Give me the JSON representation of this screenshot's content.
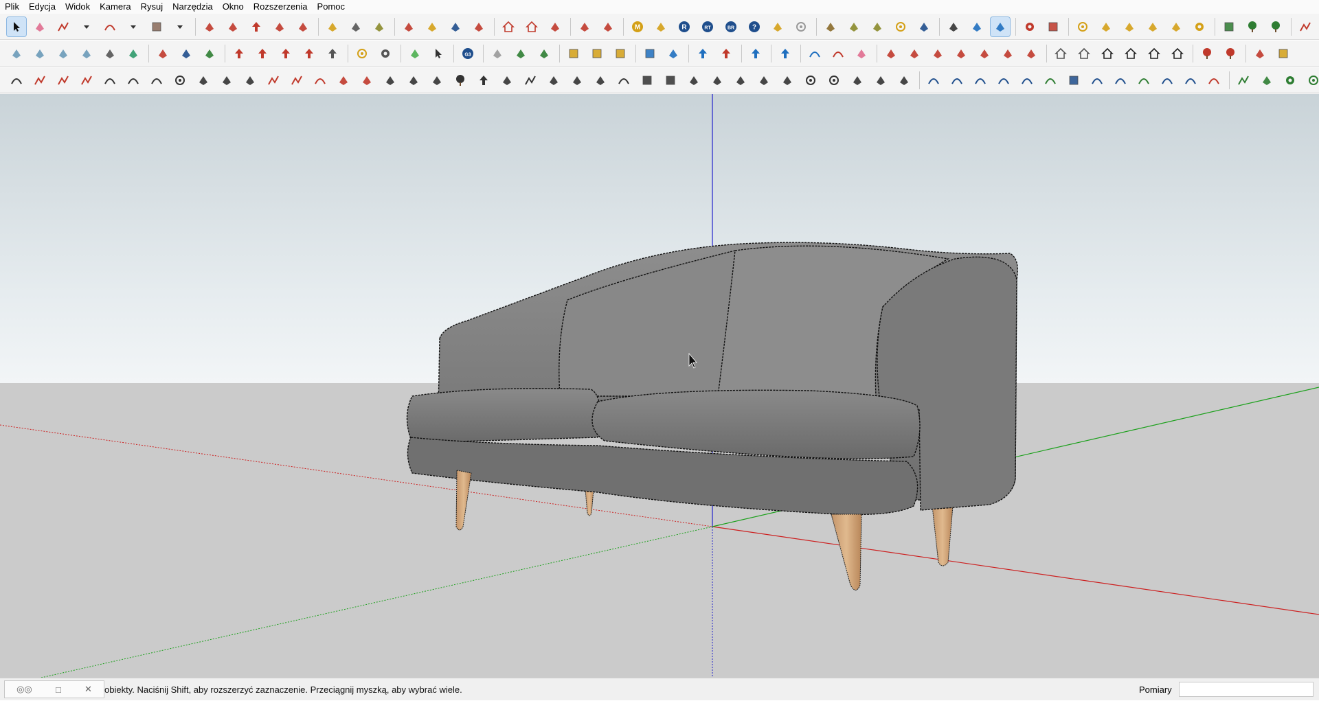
{
  "menu": [
    "Plik",
    "Edycja",
    "Widok",
    "Kamera",
    "Rysuj",
    "Narzędzia",
    "Okno",
    "Rozszerzenia",
    "Pomoc"
  ],
  "toolbar1": [
    {
      "name": "select-icon",
      "color": "#111111",
      "active": true
    },
    {
      "name": "eraser-icon",
      "color": "#e06d8f"
    },
    {
      "name": "pencil-line-icon",
      "color": "#c0392b"
    },
    {
      "name": "dropdown-arrow-icon",
      "color": "#333333"
    },
    {
      "name": "arc-icon",
      "color": "#c0392b"
    },
    {
      "name": "dropdown-arrow-icon",
      "color": "#333333"
    },
    {
      "name": "rectangle-icon",
      "color": "#8a6a5a"
    },
    {
      "name": "dropdown-arrow-icon",
      "color": "#333333"
    },
    {
      "name": "sep"
    },
    {
      "name": "push-pull-icon",
      "color": "#c0392b"
    },
    {
      "name": "follow-me-icon",
      "color": "#c0392b"
    },
    {
      "name": "move-icon",
      "color": "#c0392b"
    },
    {
      "name": "rotate-icon",
      "color": "#c0392b"
    },
    {
      "name": "scale-icon",
      "color": "#c0392b"
    },
    {
      "name": "sep"
    },
    {
      "name": "tape-measure-icon",
      "color": "#d4a017"
    },
    {
      "name": "text-icon",
      "color": "#555555"
    },
    {
      "name": "paint-bucket-icon",
      "color": "#8a8a2a"
    },
    {
      "name": "sep"
    },
    {
      "name": "orbit-icon",
      "color": "#c0392b"
    },
    {
      "name": "pan-icon",
      "color": "#d4a017"
    },
    {
      "name": "zoom-icon",
      "color": "#1f4e8c"
    },
    {
      "name": "zoom-extents-icon",
      "color": "#c0392b"
    },
    {
      "name": "sep"
    },
    {
      "name": "warehouse-icon",
      "color": "#c0392b"
    },
    {
      "name": "extension-warehouse-icon",
      "color": "#c0392b"
    },
    {
      "name": "layout-icon",
      "color": "#c0392b"
    },
    {
      "name": "sep"
    },
    {
      "name": "record-icon",
      "color": "#c0392b"
    },
    {
      "name": "vray-icon",
      "color": "#c0392b"
    },
    {
      "name": "sep"
    },
    {
      "name": "m-icon",
      "color": "#d4a017",
      "label": "M"
    },
    {
      "name": "tag-icon",
      "color": "#d4a017"
    },
    {
      "name": "r-icon",
      "color": "#1f4e8c",
      "label": "R"
    },
    {
      "name": "rt-icon",
      "color": "#1f4e8c",
      "label": "RT"
    },
    {
      "name": "br-icon",
      "color": "#1f4e8c",
      "label": "BR"
    },
    {
      "name": "help-icon",
      "color": "#1f4e8c",
      "label": "?"
    },
    {
      "name": "tag2-icon",
      "color": "#d4a017"
    },
    {
      "name": "sphere-icon",
      "color": "#999999"
    },
    {
      "name": "sep"
    },
    {
      "name": "cross-icon",
      "color": "#8a6a2a"
    },
    {
      "name": "terrain-icon",
      "color": "#8a8a2a"
    },
    {
      "name": "terrain2-icon",
      "color": "#8a8a2a"
    },
    {
      "name": "target-icon",
      "color": "#d4a017"
    },
    {
      "name": "pause-icon",
      "color": "#1f4e8c"
    },
    {
      "name": "sep"
    },
    {
      "name": "section-icon",
      "color": "#333333"
    },
    {
      "name": "camera-icon",
      "color": "#1f6fbf"
    },
    {
      "name": "render-icon",
      "color": "#1f6fbf",
      "active": true
    },
    {
      "name": "sep"
    },
    {
      "name": "gear-icon",
      "color": "#c0392b"
    },
    {
      "name": "grid-icon",
      "color": "#c0392b"
    },
    {
      "name": "sep"
    },
    {
      "name": "dot-icon",
      "color": "#d4a017"
    },
    {
      "name": "hat-icon",
      "color": "#d4a017"
    },
    {
      "name": "flag-icon",
      "color": "#d4a017"
    },
    {
      "name": "dome-icon",
      "color": "#d4a017"
    },
    {
      "name": "dome2-icon",
      "color": "#d4a017"
    },
    {
      "name": "key-icon",
      "color": "#d4a017"
    },
    {
      "name": "sep"
    },
    {
      "name": "window-icon",
      "color": "#2e7d32"
    },
    {
      "name": "tree-icon",
      "color": "#2e7d32"
    },
    {
      "name": "tree2-icon",
      "color": "#2e7d32"
    },
    {
      "name": "sep"
    },
    {
      "name": "pen-icon",
      "color": "#c0392b"
    }
  ],
  "toolbar2": [
    {
      "name": "iso-view-icon",
      "color": "#6a9ab8"
    },
    {
      "name": "top-view-icon",
      "color": "#6a9ab8"
    },
    {
      "name": "front-view-icon",
      "color": "#6a9ab8"
    },
    {
      "name": "right-view-icon",
      "color": "#6a9ab8"
    },
    {
      "name": "back-view-icon",
      "color": "#555555"
    },
    {
      "name": "left-view-icon",
      "color": "#2e9a6a"
    },
    {
      "name": "sep"
    },
    {
      "name": "solid-tool-icon",
      "color": "#c0392b"
    },
    {
      "name": "solid-tool2-icon",
      "color": "#1f4e8c"
    },
    {
      "name": "solid-tool3-icon",
      "color": "#2e7d32"
    },
    {
      "name": "sep"
    },
    {
      "name": "arrow-tool-icon",
      "color": "#c0392b"
    },
    {
      "name": "arrow-tool2-icon",
      "color": "#c0392b"
    },
    {
      "name": "arrow-tool3-icon",
      "color": "#c0392b"
    },
    {
      "name": "arrow-tool4-icon",
      "color": "#c0392b"
    },
    {
      "name": "arrow-tool5-icon",
      "color": "#555555"
    },
    {
      "name": "sep"
    },
    {
      "name": "compass-icon",
      "color": "#d4a017"
    },
    {
      "name": "tools-icon",
      "color": "#555555"
    },
    {
      "name": "sep"
    },
    {
      "name": "palette-icon",
      "color": "#4caf50"
    },
    {
      "name": "cursor-icon",
      "color": "#333333"
    },
    {
      "name": "sep"
    },
    {
      "name": "g3-icon",
      "color": "#1f4e8c",
      "label": "G3"
    },
    {
      "name": "sep"
    },
    {
      "name": "shell-icon",
      "color": "#999999"
    },
    {
      "name": "nodes-icon",
      "color": "#2e7d32"
    },
    {
      "name": "mesh-icon",
      "color": "#2e7d32"
    },
    {
      "name": "sep"
    },
    {
      "name": "box-icon",
      "color": "#d4a017"
    },
    {
      "name": "box2-icon",
      "color": "#d4a017"
    },
    {
      "name": "box3-icon",
      "color": "#d4a017"
    },
    {
      "name": "sep"
    },
    {
      "name": "cube-icon",
      "color": "#1f6fbf"
    },
    {
      "name": "bar-icon",
      "color": "#1f6fbf"
    },
    {
      "name": "sep"
    },
    {
      "name": "arrows-up-icon",
      "color": "#1f6fbf"
    },
    {
      "name": "arrows-up2-icon",
      "color": "#c0392b"
    },
    {
      "name": "sep"
    },
    {
      "name": "diag-arrow-icon",
      "color": "#1f6fbf"
    },
    {
      "name": "sep"
    },
    {
      "name": "flip-icon",
      "color": "#1f6fbf"
    },
    {
      "name": "sep"
    },
    {
      "name": "undo-curve-icon",
      "color": "#1f6fbf"
    },
    {
      "name": "redo-curve-icon",
      "color": "#c0392b"
    },
    {
      "name": "hand-icon",
      "color": "#e06d8f"
    },
    {
      "name": "sep"
    },
    {
      "name": "stair-icon",
      "color": "#c0392b"
    },
    {
      "name": "stair2-icon",
      "color": "#c0392b"
    },
    {
      "name": "ar-icon",
      "color": "#c0392b"
    },
    {
      "name": "av-icon",
      "color": "#c0392b"
    },
    {
      "name": "an-icon",
      "color": "#c0392b"
    },
    {
      "name": "ax-icon",
      "color": "#c0392b"
    },
    {
      "name": "af-icon",
      "color": "#c0392b"
    },
    {
      "name": "sep"
    },
    {
      "name": "house-icon",
      "color": "#555555"
    },
    {
      "name": "door-icon",
      "color": "#555555"
    },
    {
      "name": "home-icon",
      "color": "#222222"
    },
    {
      "name": "store-icon",
      "color": "#222222"
    },
    {
      "name": "home2-icon",
      "color": "#222222"
    },
    {
      "name": "store2-icon",
      "color": "#222222"
    },
    {
      "name": "sep"
    },
    {
      "name": "plant-icon",
      "color": "#c0392b"
    },
    {
      "name": "plant2-icon",
      "color": "#c0392b"
    },
    {
      "name": "sep"
    },
    {
      "name": "brick-icon",
      "color": "#c0392b"
    },
    {
      "name": "frame-icon",
      "color": "#d4a017"
    }
  ],
  "toolbar3": [
    {
      "name": "curve-icon",
      "color": "#333333"
    },
    {
      "name": "polyline-icon",
      "color": "#c0392b"
    },
    {
      "name": "path-icon",
      "color": "#c0392b"
    },
    {
      "name": "cross-lines-icon",
      "color": "#c0392b"
    },
    {
      "name": "spiral-gear-icon",
      "color": "#333333"
    },
    {
      "name": "loop-icon",
      "color": "#333333"
    },
    {
      "name": "helix-icon",
      "color": "#333333"
    },
    {
      "name": "donut-icon",
      "color": "#333333"
    },
    {
      "name": "shell2-icon",
      "color": "#333333"
    },
    {
      "name": "bend-icon",
      "color": "#333333"
    },
    {
      "name": "fillet-icon",
      "color": "#333333"
    },
    {
      "name": "chamfer-icon",
      "color": "#c0392b"
    },
    {
      "name": "line-tool-icon",
      "color": "#c0392b"
    },
    {
      "name": "arc-tool-icon",
      "color": "#c0392b"
    },
    {
      "name": "stairs-icon",
      "color": "#c0392b"
    },
    {
      "name": "triangle-tool-icon",
      "color": "#c0392b"
    },
    {
      "name": "columns-icon",
      "color": "#333333"
    },
    {
      "name": "columns2-icon",
      "color": "#333333"
    },
    {
      "name": "columns3-icon",
      "color": "#333333"
    },
    {
      "name": "leaf-icon",
      "color": "#333333"
    },
    {
      "name": "arrow-left-tool-icon",
      "color": "#333333"
    },
    {
      "name": "stack-icon",
      "color": "#333333"
    },
    {
      "name": "slope-icon",
      "color": "#333333"
    },
    {
      "name": "fork-icon",
      "color": "#333333"
    },
    {
      "name": "fork2-icon",
      "color": "#333333"
    },
    {
      "name": "fork3-icon",
      "color": "#333333"
    },
    {
      "name": "arch-icon",
      "color": "#333333"
    },
    {
      "name": "panel-icon",
      "color": "#333333"
    },
    {
      "name": "panel2-icon",
      "color": "#333333"
    },
    {
      "name": "flag-tool-icon",
      "color": "#333333"
    },
    {
      "name": "hatch-icon",
      "color": "#333333"
    },
    {
      "name": "hatch2-icon",
      "color": "#333333"
    },
    {
      "name": "hatch3-icon",
      "color": "#333333"
    },
    {
      "name": "comb-icon",
      "color": "#333333"
    },
    {
      "name": "ring-icon",
      "color": "#333333"
    },
    {
      "name": "ring2-icon",
      "color": "#333333"
    },
    {
      "name": "wave-icon",
      "color": "#333333"
    },
    {
      "name": "wave2-icon",
      "color": "#333333"
    },
    {
      "name": "diamond-icon",
      "color": "#333333"
    },
    {
      "name": "sep"
    },
    {
      "name": "bezier-icon",
      "color": "#1f4e8c"
    },
    {
      "name": "bezier2-icon",
      "color": "#1f4e8c"
    },
    {
      "name": "bezier3-icon",
      "color": "#1f4e8c"
    },
    {
      "name": "bezier4-icon",
      "color": "#1f4e8c"
    },
    {
      "name": "bezier5-icon",
      "color": "#1f4e8c"
    },
    {
      "name": "arc-green-icon",
      "color": "#2e7d32"
    },
    {
      "name": "square-icon",
      "color": "#1f4e8c"
    },
    {
      "name": "spiral-icon",
      "color": "#1f4e8c"
    },
    {
      "name": "arc-blue-icon",
      "color": "#1f4e8c"
    },
    {
      "name": "arc-green2-icon",
      "color": "#2e7d32"
    },
    {
      "name": "hook-icon",
      "color": "#1f4e8c"
    },
    {
      "name": "hook2-icon",
      "color": "#1f4e8c"
    },
    {
      "name": "arc-red-icon",
      "color": "#c0392b"
    },
    {
      "name": "sep"
    },
    {
      "name": "zigzag-icon",
      "color": "#2e7d32"
    },
    {
      "name": "polygon-icon",
      "color": "#2e7d32"
    },
    {
      "name": "wrench-icon",
      "color": "#2e7d32"
    },
    {
      "name": "circle-icon",
      "color": "#2e7d32"
    }
  ],
  "status": {
    "text": "obiekty. Naciśnij Shift, aby rozszerzyć zaznaczenie. Przeciągnij myszką, aby wybrać wiele.",
    "measurements_label": "Pomiary",
    "measurements_value": "",
    "ctrl_symbols": [
      "◎◎",
      "□",
      "✕"
    ]
  },
  "scene": {
    "sofa_color": "#7c7c7c",
    "leg_color": "#d2a77a",
    "axis_red": "#cc1f1f",
    "axis_green": "#1aa01a",
    "axis_blue": "#1f1fcc"
  }
}
